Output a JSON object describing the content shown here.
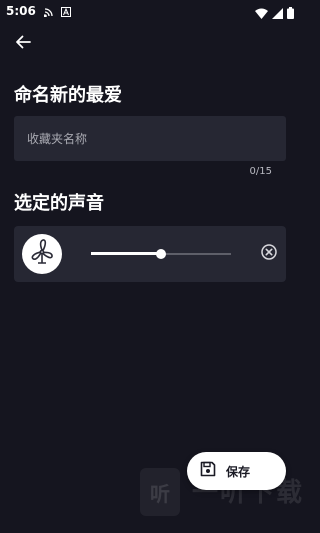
{
  "status_bar": {
    "time": "5:06",
    "left_icons": [
      "cast-icon",
      "notification-a-icon"
    ],
    "right_icons": [
      "wifi-icon",
      "signal-icon",
      "battery-icon"
    ]
  },
  "header": {
    "back_icon": "arrow-left-icon"
  },
  "name_section": {
    "title": "命名新的最爱",
    "input_placeholder": "收藏夹名称",
    "input_value": "",
    "char_count": "0/15"
  },
  "sounds_section": {
    "title": "选定的声音",
    "items": [
      {
        "icon": "fan-icon",
        "volume": 0.5,
        "remove_icon": "close-circle-icon"
      }
    ]
  },
  "save_button": {
    "label": "保存",
    "icon": "save-icon"
  },
  "watermark": {
    "logo_text": "听",
    "text": "一听下载"
  },
  "colors": {
    "background": "#15151f",
    "card": "#262733",
    "text": "#ffffff",
    "muted": "#a9aab2",
    "save_button_bg": "#ffffff"
  }
}
